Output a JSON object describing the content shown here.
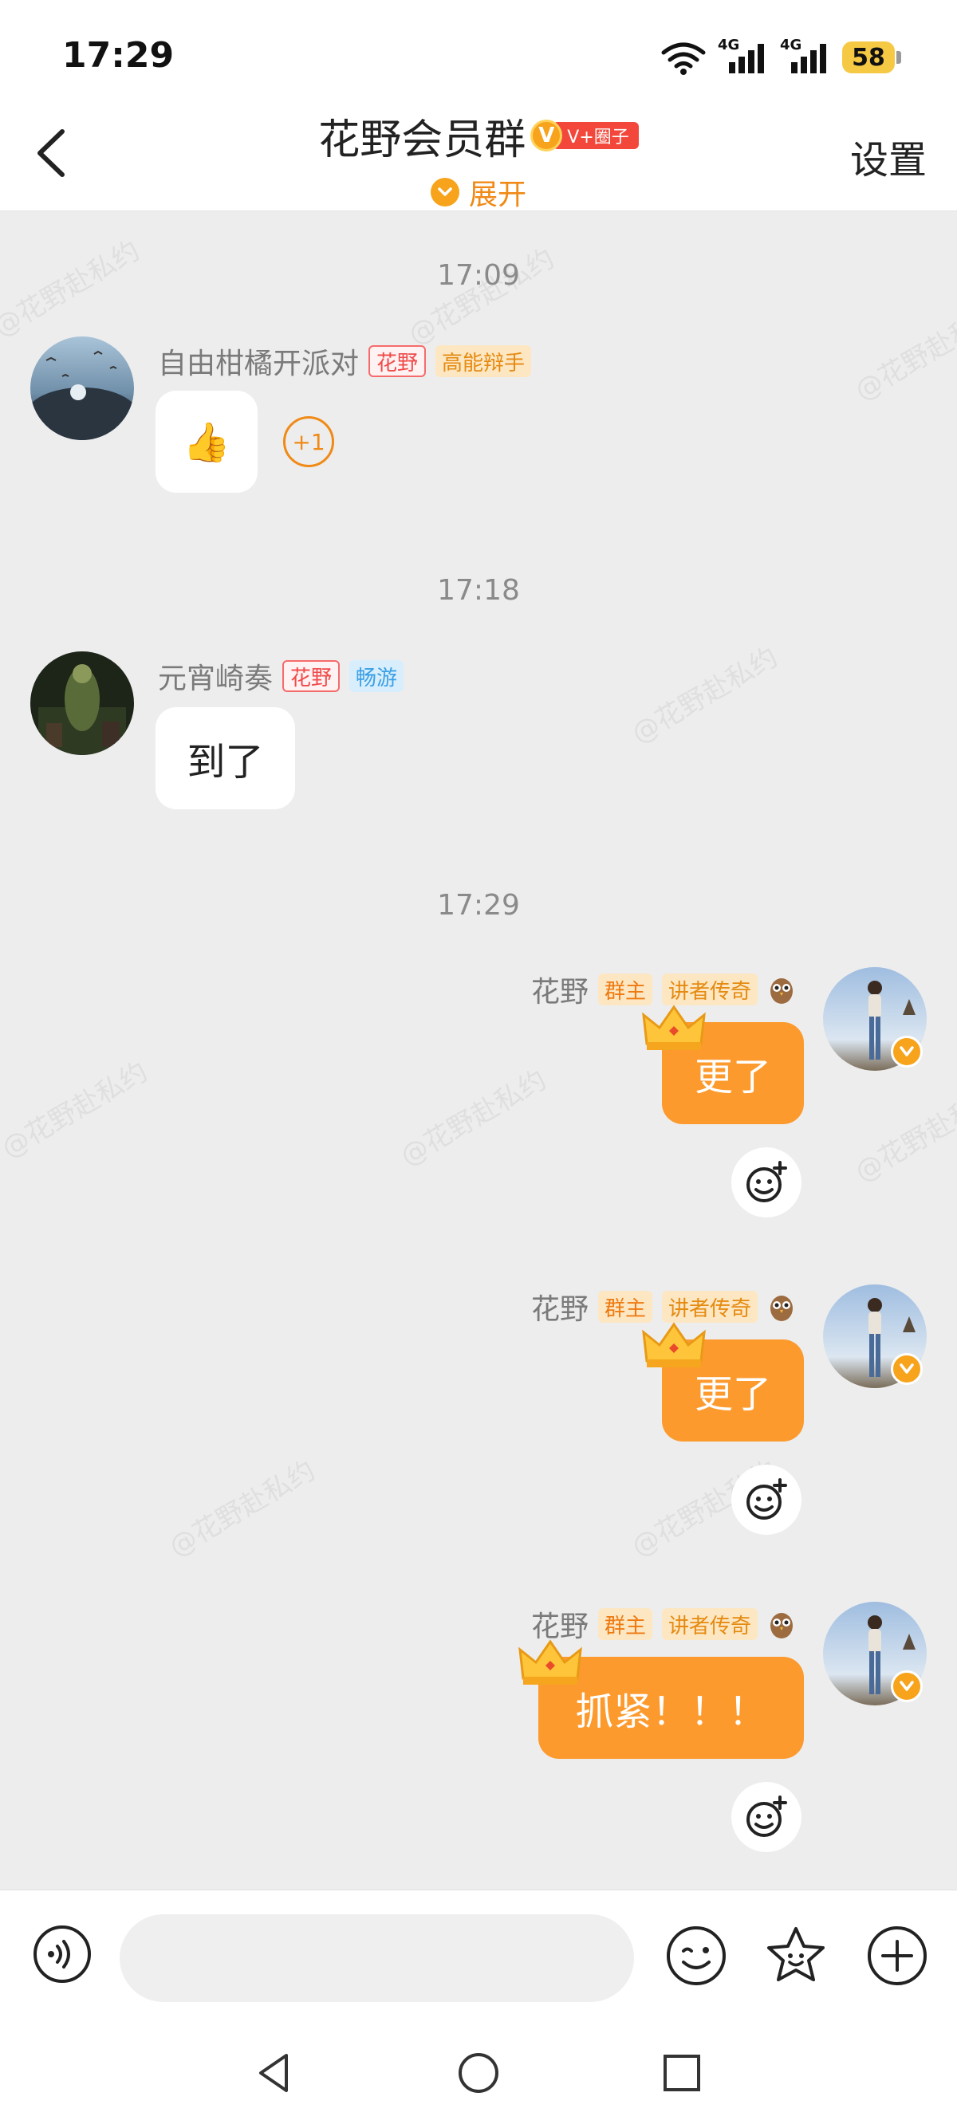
{
  "status_bar": {
    "time": "17:29",
    "battery": "58",
    "network_1": "4G",
    "network_2": "4G",
    "wifi_label": "6"
  },
  "header": {
    "title": "花野会员群",
    "vip_badge": "V",
    "vip_tag": "V+圈子",
    "expand_label": "展开",
    "settings_label": "设置"
  },
  "chat": {
    "timestamps": [
      "17:09",
      "17:18",
      "17:29"
    ],
    "messages": [
      {
        "sender": "自由柑橘开派对",
        "tags": [
          "花野",
          "高能辩手"
        ],
        "content": "👍",
        "reaction": "+1"
      },
      {
        "sender": "元宵崎奏",
        "tags": [
          "花野",
          "畅游"
        ],
        "content": "到了"
      },
      {
        "sender": "花野",
        "tags": [
          "群主",
          "讲者传奇"
        ],
        "content": "更了"
      },
      {
        "sender": "花野",
        "tags": [
          "群主",
          "讲者传奇"
        ],
        "content": "更了"
      },
      {
        "sender": "花野",
        "tags": [
          "群主",
          "讲者传奇"
        ],
        "content": "抓紧！！！"
      }
    ],
    "watermark": "@花野赴私约"
  },
  "input_bar": {
    "placeholder": ""
  },
  "colors": {
    "accent": "#fd9a2e",
    "vip": "#f7a31b",
    "tag_red": "#f04a4a"
  },
  "icons": [
    "back-arrow-icon",
    "voice-icon",
    "emoji-icon",
    "sticker-star-icon",
    "plus-icon",
    "add-reaction-icon",
    "crown-icon",
    "owl-icon",
    "verified-icon",
    "nav-back-icon",
    "nav-home-icon",
    "nav-recents-icon"
  ]
}
